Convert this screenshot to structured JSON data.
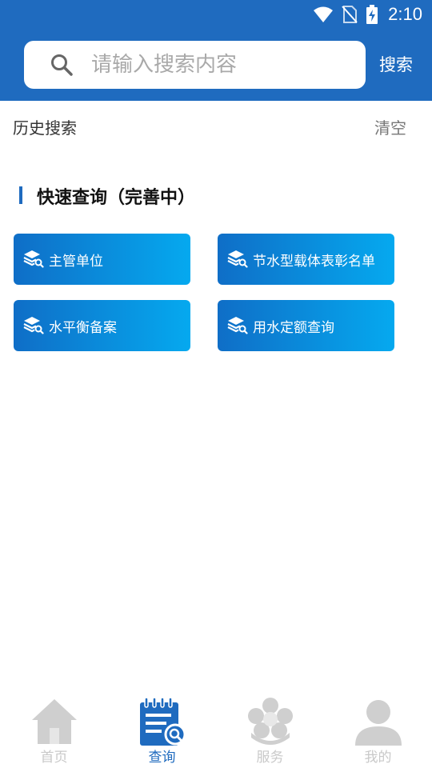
{
  "status_bar": {
    "time": "2:10",
    "icons": [
      "wifi-icon",
      "no-sim-icon",
      "battery-charging-icon"
    ]
  },
  "search": {
    "placeholder": "请输入搜索内容",
    "value": "",
    "button_label": "搜索",
    "icon": "search-icon"
  },
  "history": {
    "title": "历史搜索",
    "clear_label": "清空"
  },
  "quick": {
    "title": "快速查询（完善中）",
    "items": [
      {
        "label": "主管单位",
        "icon": "layers-search-icon"
      },
      {
        "label": "节水型载体表彰名单",
        "icon": "layers-search-icon"
      },
      {
        "label": "水平衡备案",
        "icon": "layers-search-icon"
      },
      {
        "label": "用水定额查询",
        "icon": "layers-search-icon"
      }
    ]
  },
  "tabs": [
    {
      "label": "首页",
      "icon": "home-icon",
      "active": false
    },
    {
      "label": "查询",
      "icon": "notepad-search-icon",
      "active": true
    },
    {
      "label": "服务",
      "icon": "flower-icon",
      "active": false
    },
    {
      "label": "我的",
      "icon": "person-icon",
      "active": false
    }
  ],
  "colors": {
    "primary": "#1f6bbf",
    "button_gradient_start": "#0f6ec7",
    "button_gradient_end": "#05a9ef",
    "inactive_tab": "#c9c9c9"
  }
}
